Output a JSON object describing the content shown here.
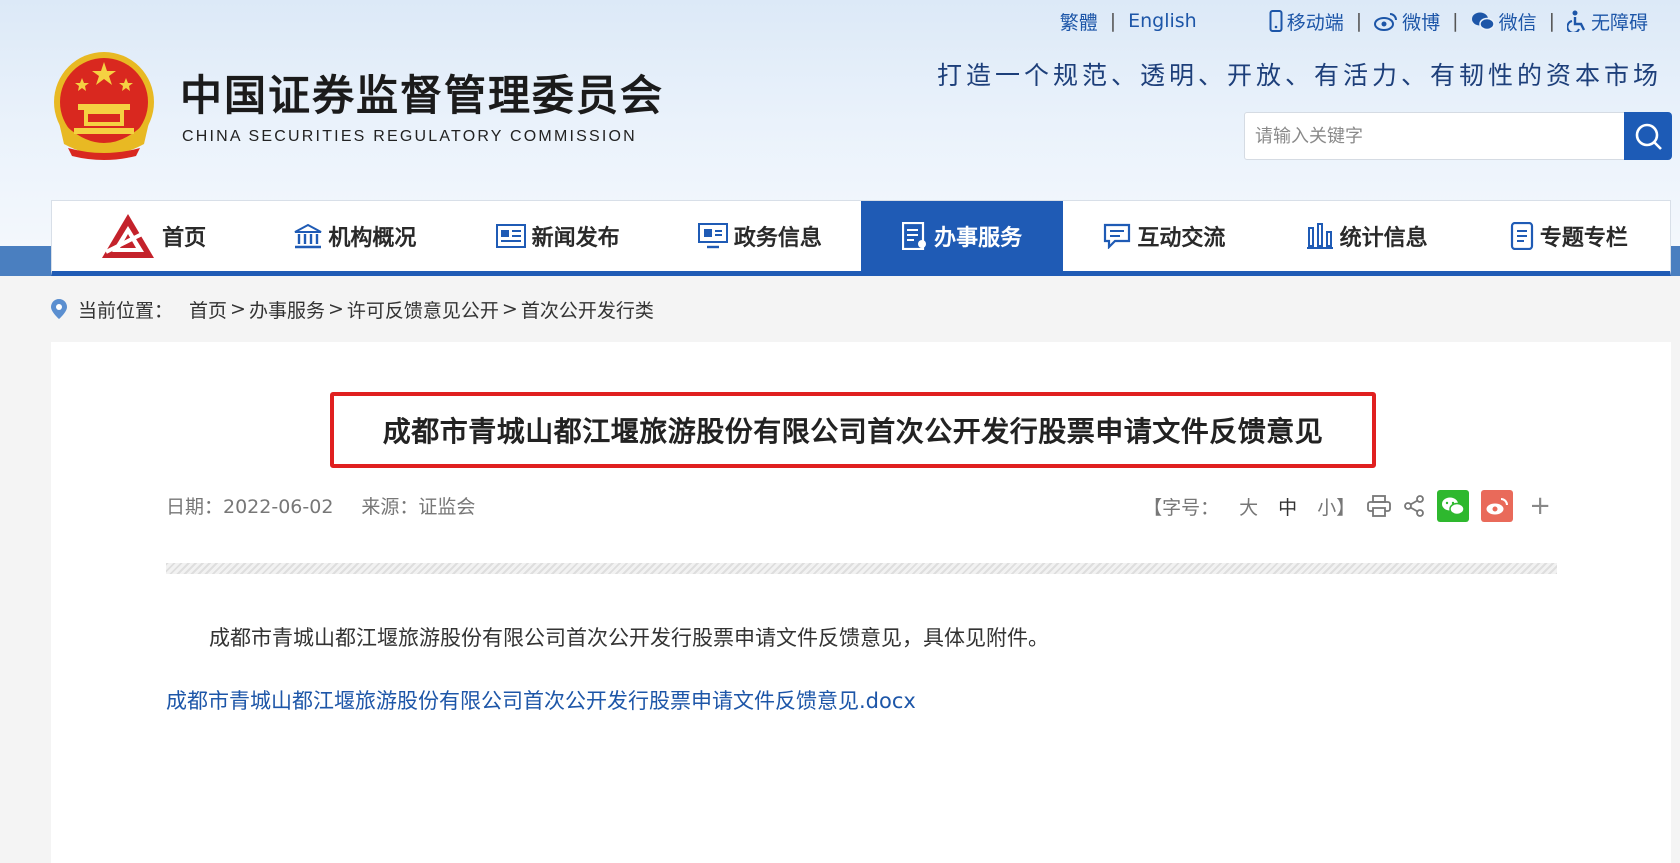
{
  "top_links": {
    "traditional": "繁體",
    "english": "English",
    "mobile": "移动端",
    "weibo": "微博",
    "wechat": "微信",
    "accessibility": "无障碍"
  },
  "site": {
    "title": "中国证券监督管理委员会",
    "subtitle": "CHINA SECURITIES REGULATORY COMMISSION",
    "slogan": "打造一个规范、透明、开放、有活力、有韧性的资本市场"
  },
  "search": {
    "placeholder": "请输入关键字"
  },
  "nav": {
    "items": [
      {
        "label": "首页",
        "icon": "csrc-logo-icon"
      },
      {
        "label": "机构概况",
        "icon": "building-icon"
      },
      {
        "label": "新闻发布",
        "icon": "newspaper-icon"
      },
      {
        "label": "政务信息",
        "icon": "monitor-icon"
      },
      {
        "label": "办事服务",
        "icon": "document-icon",
        "active": true
      },
      {
        "label": "互动交流",
        "icon": "chat-icon"
      },
      {
        "label": "统计信息",
        "icon": "bar-chart-icon"
      },
      {
        "label": "专题专栏",
        "icon": "notes-icon"
      }
    ]
  },
  "breadcrumb": {
    "label": "当前位置：",
    "items": [
      "首页",
      "办事服务",
      "许可反馈意见公开",
      "首次公开发行类"
    ],
    "separator": ">"
  },
  "article": {
    "title": "成都市青城山都江堰旅游股份有限公司首次公开发行股票申请文件反馈意见",
    "date": "日期：2022-06-02",
    "source": "来源：证监会",
    "font_size_label": "【字号：",
    "font_large": "大",
    "font_medium": "中",
    "font_small": "小】",
    "plus": "+",
    "body": "成都市青城山都江堰旅游股份有限公司首次公开发行股票申请文件反馈意见，具体见附件。",
    "attachment": "成都市青城山都江堰旅游股份有限公司首次公开发行股票申请文件反馈意见.docx"
  },
  "colors": {
    "brand_blue": "#1f5bb5",
    "link_blue": "#1d56a8",
    "title_frame_red": "#e02020",
    "wechat_green": "#2eb82e",
    "weibo_red": "#e96a5a"
  }
}
